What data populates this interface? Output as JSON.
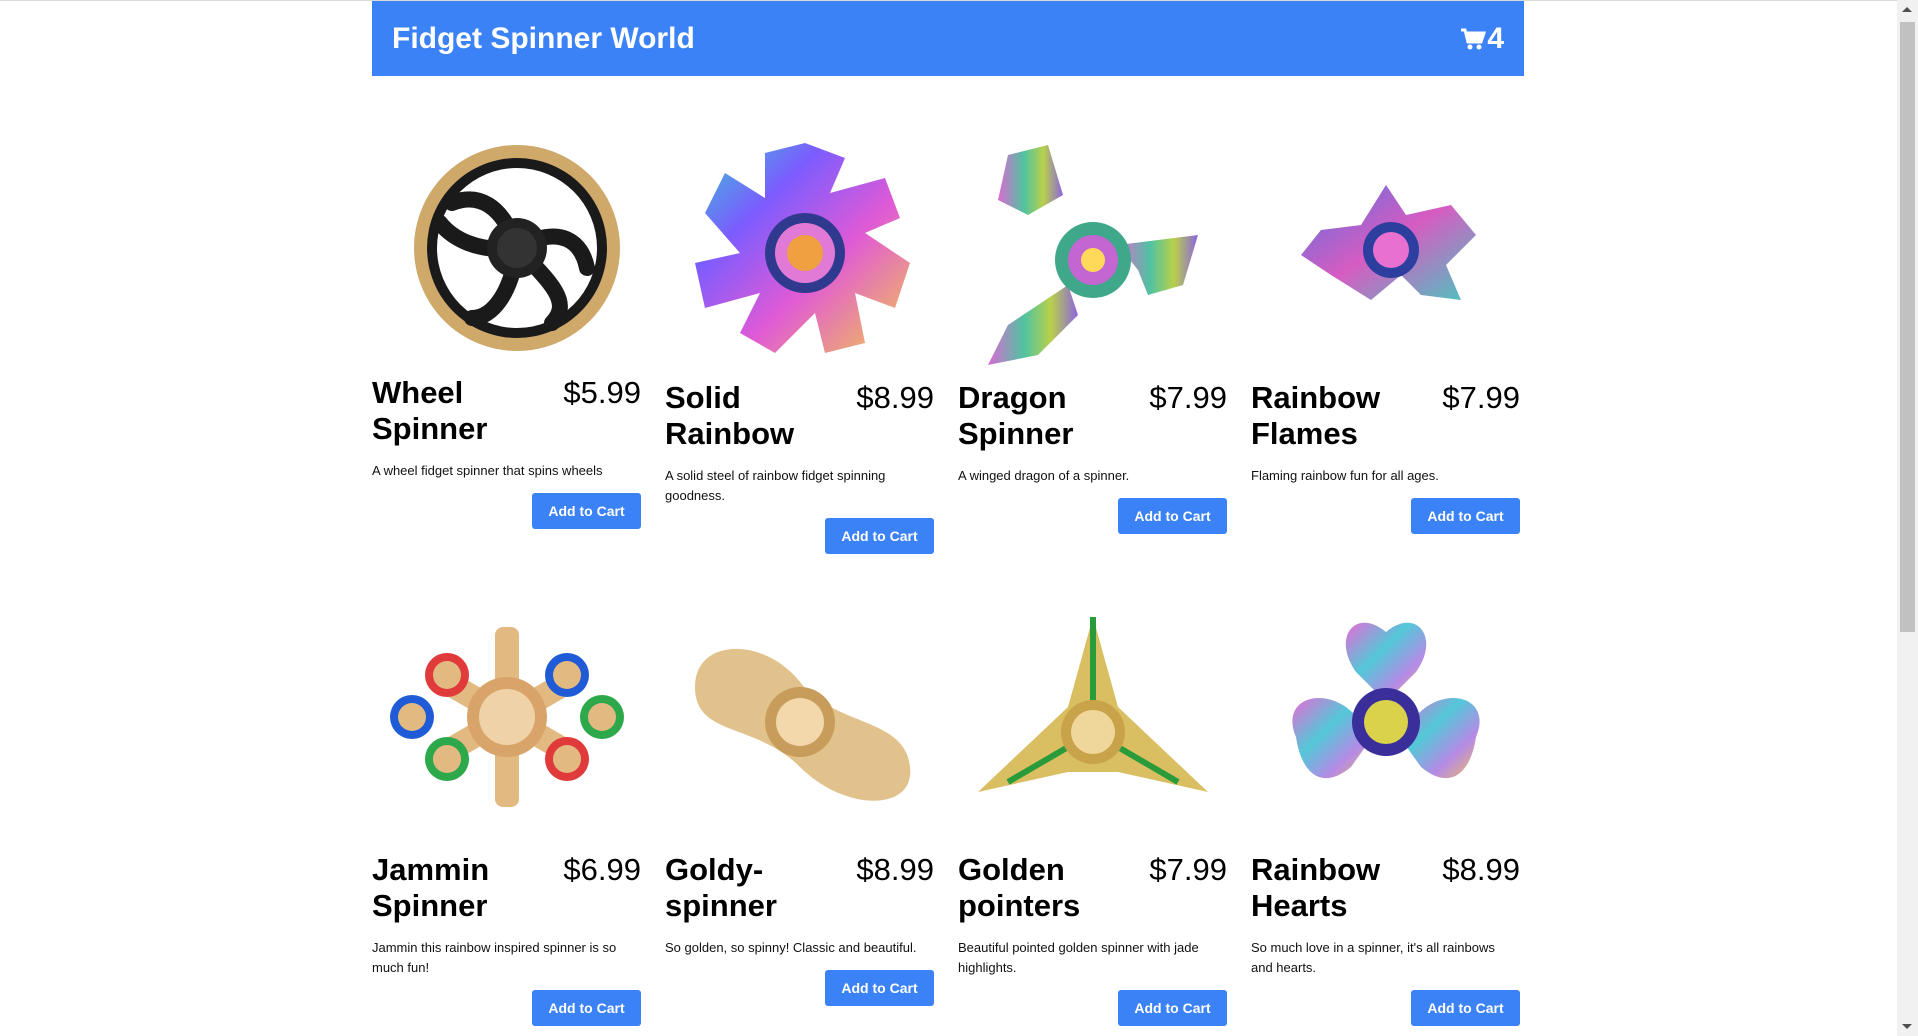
{
  "header": {
    "title": "Fidget Spinner World",
    "cart_icon": "cart-icon",
    "cart_count": "4"
  },
  "products": [
    {
      "name": "Wheel Spinner",
      "price": "$5.99",
      "desc": "A wheel fidget spinner that spins wheels",
      "button": "Add to Cart",
      "image": "wheel-spinner-image"
    },
    {
      "name": "Solid Rainbow",
      "price": "$8.99",
      "desc": "A solid steel of rainbow fidget spinning goodness.",
      "button": "Add to Cart",
      "image": "solid-rainbow-image"
    },
    {
      "name": "Dragon Spinner",
      "price": "$7.99",
      "desc": "A winged dragon of a spinner.",
      "button": "Add to Cart",
      "image": "dragon-spinner-image"
    },
    {
      "name": "Rainbow Flames",
      "price": "$7.99",
      "desc": "Flaming rainbow fun for all ages.",
      "button": "Add to Cart",
      "image": "rainbow-flames-image"
    },
    {
      "name": "Jammin Spinner",
      "price": "$6.99",
      "desc": "Jammin this rainbow inspired spinner is so much fun!",
      "button": "Add to Cart",
      "image": "jammin-spinner-image"
    },
    {
      "name": "Goldy-spinner",
      "price": "$8.99",
      "desc": "So golden, so spinny! Classic and beautiful.",
      "button": "Add to Cart",
      "image": "goldy-spinner-image"
    },
    {
      "name": "Golden pointers",
      "price": "$7.99",
      "desc": "Beautiful pointed golden spinner with jade highlights.",
      "button": "Add to Cart",
      "image": "golden-pointers-image"
    },
    {
      "name": "Rainbow Hearts",
      "price": "$8.99",
      "desc": "So much love in a spinner, it's all rainbows and hearts.",
      "button": "Add to Cart",
      "image": "rainbow-hearts-image"
    }
  ],
  "colors": {
    "accent": "#3b82f6",
    "header_text": "#ffffff"
  }
}
